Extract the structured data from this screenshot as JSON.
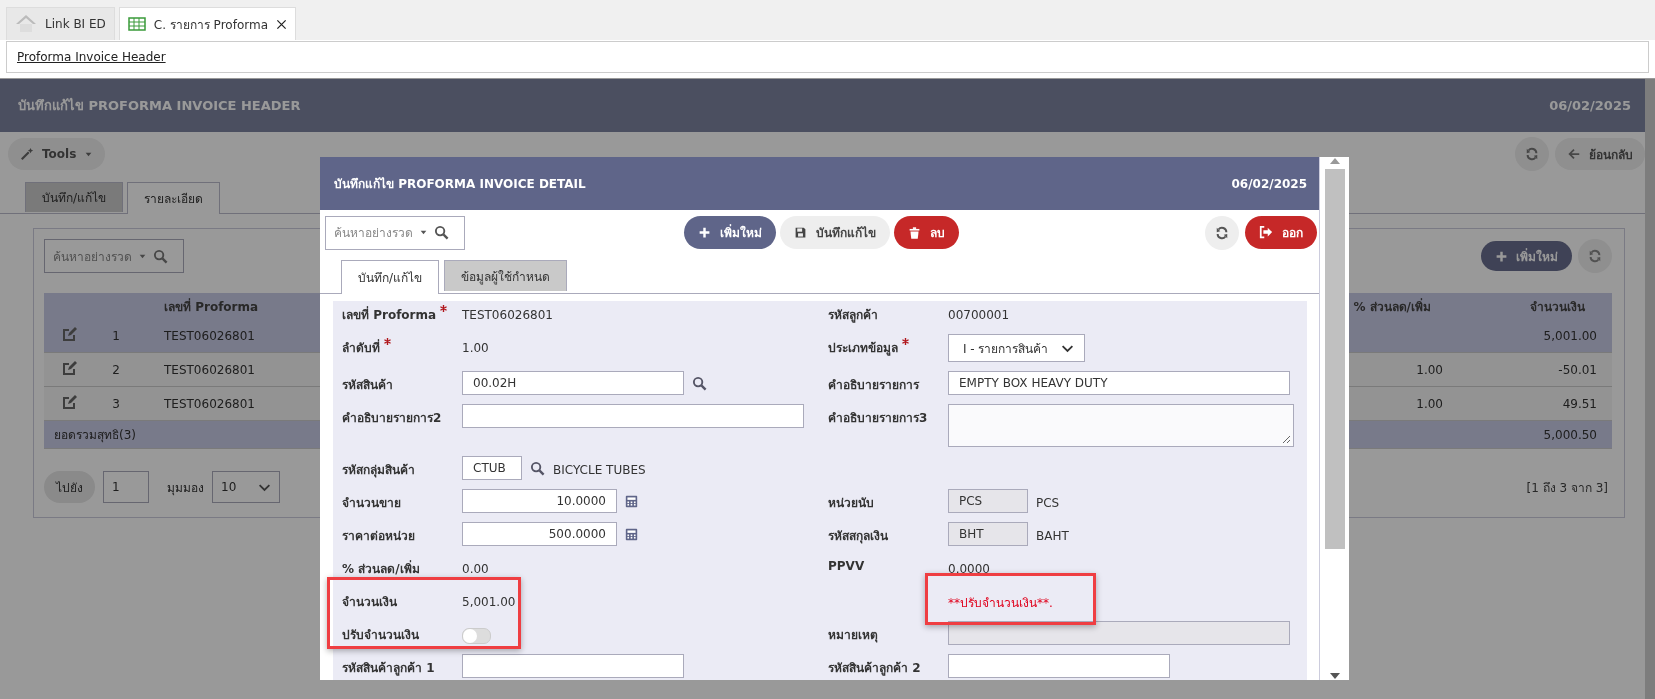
{
  "browser_tabs": [
    {
      "label": "Link BI ED",
      "kind": "home",
      "selected": false,
      "closable": false
    },
    {
      "label": "C. รายการ Proforma",
      "kind": "sheet",
      "selected": true,
      "closable": true
    }
  ],
  "breadcrumb": {
    "link": "Proforma Invoice Header"
  },
  "page": {
    "title": "บันทึกแก้ไข PROFORMA INVOICE HEADER",
    "date": "06/02/2025",
    "tools_button": "Tools",
    "back_button": "ย้อนกลับ",
    "tabs": [
      {
        "label": "บันทึก/แก้ไข",
        "selected": false
      },
      {
        "label": "รายละเอียด",
        "selected": true
      }
    ],
    "search": {
      "placeholder": "ค้นหาอย่างรวด"
    },
    "add_button": "เพิ่มใหม่",
    "table": {
      "columns": [
        "เลขที่ Proforma",
        "% ส่วนลด/เพิ่ม",
        "จำนวนเงิน"
      ],
      "rows": [
        {
          "no": "1",
          "proforma": "TEST06026801",
          "amount": "5,001.00",
          "selected": true
        },
        {
          "no": "2",
          "proforma": "TEST06026801",
          "discount": "1.00",
          "amount": "-50.01",
          "selected": false
        },
        {
          "no": "3",
          "proforma": "TEST06026801",
          "discount": "1.00",
          "amount": "49.51",
          "selected": false
        }
      ],
      "total": {
        "label": "ยอดรวมสุทธิ(3)",
        "amount": "5,000.50"
      }
    },
    "pager": {
      "goto_button": "ไปยัง",
      "page": "1",
      "view_label": "มุมมอง",
      "page_size": "10",
      "summary": "[1 ถึง 3 จาก 3]"
    }
  },
  "modal": {
    "title": "บันทึกแก้ไข PROFORMA INVOICE DETAIL",
    "date": "06/02/2025",
    "search": {
      "placeholder": "ค้นหาอย่างรวด"
    },
    "actions": [
      {
        "label": "เพิ่มใหม่",
        "kind": "add"
      },
      {
        "label": "บันทึกแก้ไข",
        "kind": "save"
      },
      {
        "label": "ลบ",
        "kind": "delete"
      }
    ],
    "exit_button": "ออก",
    "tabs": [
      {
        "label": "บันทึก/แก้ไข",
        "selected": true
      },
      {
        "label": "ข้อมูลผู้ใช้กำหนด",
        "selected": false
      }
    ],
    "form": {
      "rows": [
        {
          "left": {
            "label": "เลขที่ Proforma",
            "required": true,
            "kind": "text",
            "value": "TEST06026801"
          },
          "right": {
            "label": "รหัสลูกค้า",
            "required": false,
            "kind": "text",
            "value": "00700001"
          }
        },
        {
          "left": {
            "label": "ลำดับที่",
            "required": true,
            "kind": "text",
            "value": "1.00"
          },
          "right": {
            "label": "ประเภทข้อมูล",
            "required": true,
            "kind": "select",
            "value": "I - รายการสินค้า"
          }
        },
        {
          "left": {
            "label": "รหัสสินค้า",
            "required": false,
            "kind": "lookup",
            "value": "00.02H"
          },
          "right": {
            "label": "คำอธิบายรายการ",
            "required": false,
            "kind": "wideinput",
            "value": "EMPTY BOX HEAVY DUTY",
            "readonly": false
          }
        },
        {
          "left": {
            "label": "คำอธิบายรายการ2",
            "required": false,
            "kind": "wideinput",
            "readonly": false
          },
          "right": {
            "label": "คำอธิบายรายการ3",
            "required": false,
            "kind": "textarea"
          }
        },
        {
          "left": {
            "label": "รหัสกลุ่มสินค้า",
            "required": false,
            "kind": "grouplookup",
            "value": "CTUB",
            "description": "BICYCLE TUBES"
          }
        },
        {
          "left": {
            "label": "จำนวนขาย",
            "required": false,
            "kind": "calc",
            "value": "10.0000"
          },
          "right": {
            "label": "หน่วยนับ",
            "required": false,
            "kind": "unit",
            "value": "PCS",
            "readonly": true,
            "suffix": "PCS"
          }
        },
        {
          "left": {
            "label": "ราคาต่อหน่วย",
            "required": false,
            "kind": "calc",
            "value": "500.0000"
          },
          "right": {
            "label": "รหัสสกุลเงิน",
            "required": false,
            "kind": "unit",
            "value": "BHT",
            "readonly": true,
            "suffix": "BAHT"
          }
        },
        {
          "left": {
            "label": "% ส่วนลด/เพิ่ม",
            "required": false,
            "kind": "text",
            "value": "0.00"
          },
          "right": {
            "label": "PPVV",
            "required": false,
            "kind": "text",
            "value": "0.0000"
          }
        },
        {
          "left": {
            "label": "จำนวนเงิน",
            "required": false,
            "kind": "text",
            "value": "5,001.00"
          },
          "right": {
            "kind": "note",
            "value": "**ปรับจำนวนเงิน**."
          }
        },
        {
          "left": {
            "label": "ปรับจำนวนเงิน",
            "required": false,
            "kind": "toggle",
            "on": false
          },
          "right": {
            "label": "หมายเหตุ",
            "required": false,
            "kind": "wideinput",
            "readonly": true
          }
        },
        {
          "left": {
            "label": "รหัสสินค้าลูกค้า 1",
            "required": false,
            "kind": "input",
            "readonly": false
          },
          "right": {
            "label": "รหัสสินค้าลูกค้า 2",
            "required": false,
            "kind": "input",
            "readonly": false
          }
        }
      ]
    }
  }
}
